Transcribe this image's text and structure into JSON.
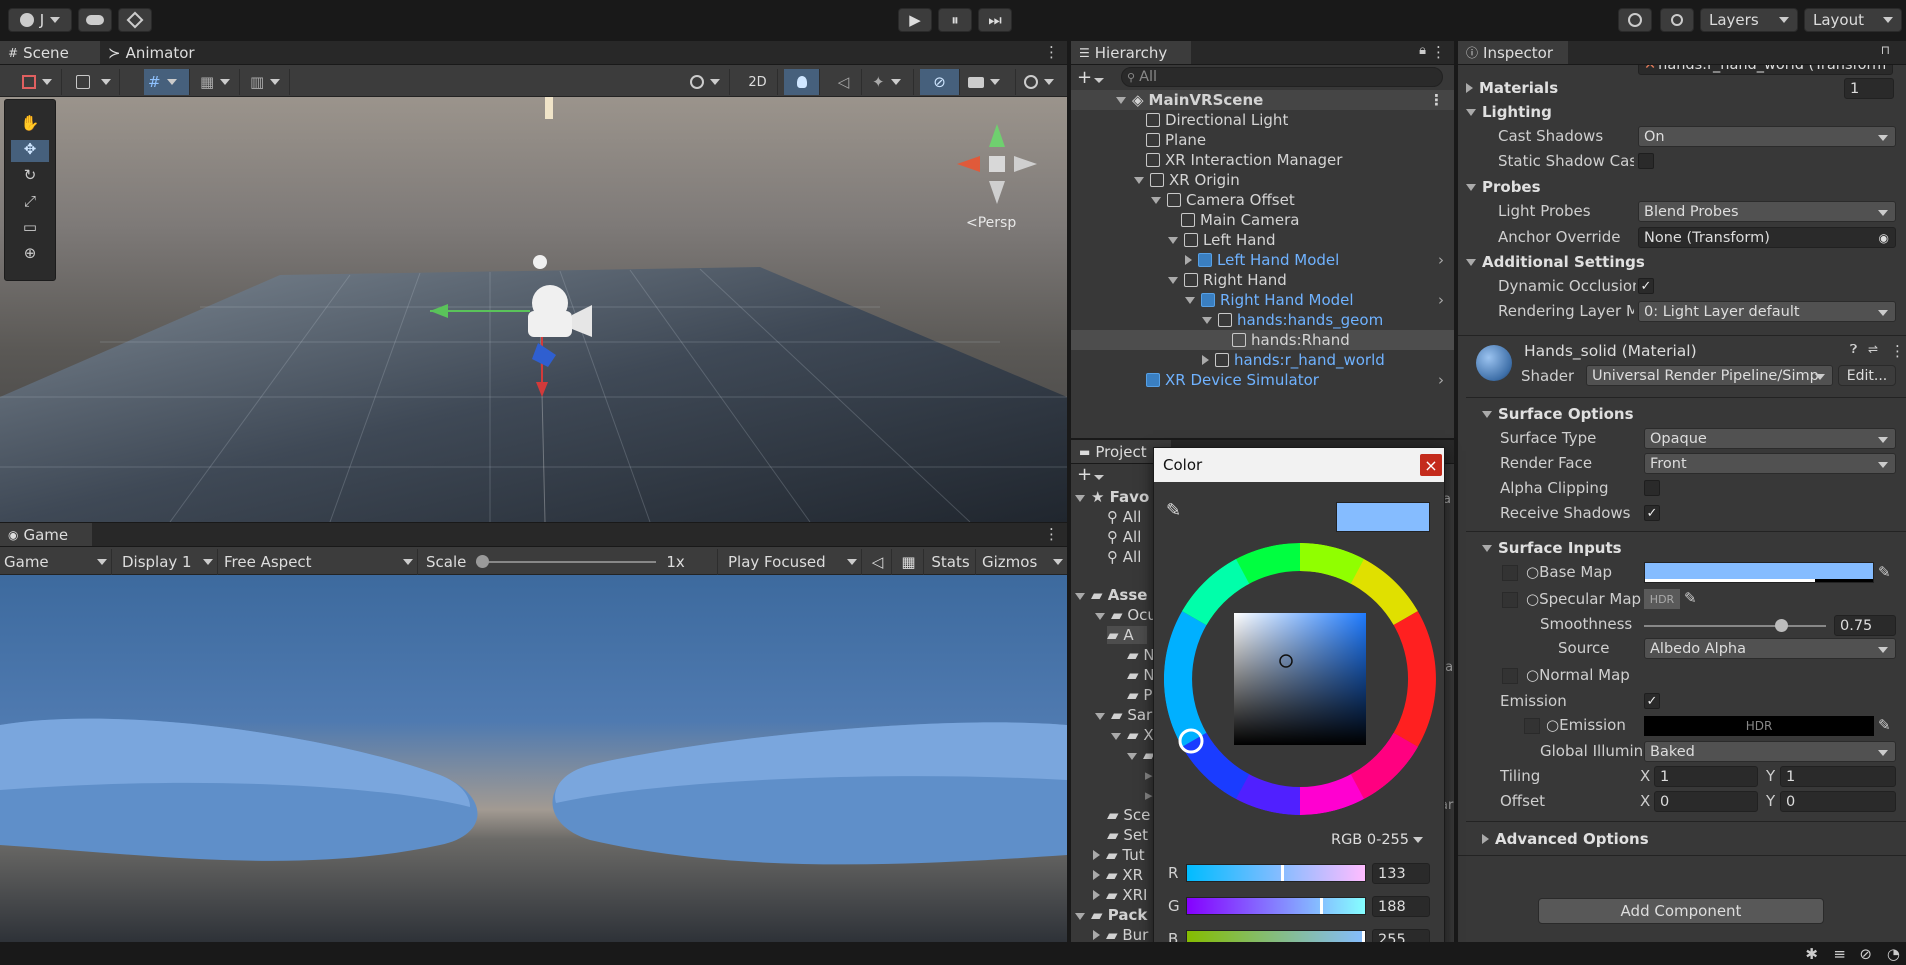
{
  "topbar": {
    "account": "J",
    "play": "▶",
    "pause": "⏸",
    "step": "⏭",
    "layers": "Layers",
    "layout": "Layout"
  },
  "scene": {
    "tabs": [
      "Scene",
      "Animator"
    ],
    "persp": "Persp",
    "mode2d": "2D"
  },
  "game": {
    "tab": "Game",
    "view": "Game",
    "display": "Display 1",
    "aspect": "Free Aspect",
    "scale_label": "Scale",
    "scale_value": "1x",
    "play_mode": "Play Focused",
    "stats": "Stats",
    "gizmos": "Gizmos"
  },
  "hierarchy": {
    "title": "Hierarchy",
    "search_placeholder": "All",
    "items": [
      {
        "label": "MainVRScene"
      },
      {
        "label": "Directional Light"
      },
      {
        "label": "Plane"
      },
      {
        "label": "XR Interaction Manager"
      },
      {
        "label": "XR Origin"
      },
      {
        "label": "Camera Offset"
      },
      {
        "label": "Main Camera"
      },
      {
        "label": "Left Hand"
      },
      {
        "label": "Left Hand Model"
      },
      {
        "label": "Right Hand"
      },
      {
        "label": "Right Hand Model"
      },
      {
        "label": "hands:hands_geom"
      },
      {
        "label": "hands:Rhand"
      },
      {
        "label": "hands:r_hand_world"
      },
      {
        "label": "XR Device Simulator"
      }
    ]
  },
  "project": {
    "title": "Project",
    "favorites": "Favo",
    "fav_items": [
      "All",
      "All",
      "All"
    ],
    "assets": "Asse",
    "folders": [
      "Ocu",
      "A",
      "N",
      "N",
      "P",
      "Sar",
      "X",
      "",
      "",
      "",
      "Sce",
      "Set",
      "Tut",
      "XR",
      "XRI"
    ],
    "packages": "Pack",
    "pkg_first": "Bur",
    "right_frag_a": "a",
    "right_frag_b": "ta",
    "right_frag_c": "ar"
  },
  "color_picker": {
    "title": "Color",
    "close": "×",
    "mode": "RGB 0-255",
    "channels": [
      {
        "label": "R",
        "value": "133"
      },
      {
        "label": "G",
        "value": "188"
      },
      {
        "label": "B",
        "value": "255"
      }
    ],
    "swatch": "#85bcff"
  },
  "inspector": {
    "title": "Inspector",
    "root_bone": "hands:r_hand_world (Transform",
    "materials_label": "Materials",
    "materials_count": "1",
    "lighting": "Lighting",
    "cast_shadows_label": "Cast Shadows",
    "cast_shadows": "On",
    "static_shadow_label": "Static Shadow Cas",
    "probes": "Probes",
    "light_probes_label": "Light Probes",
    "light_probes": "Blend Probes",
    "anchor_label": "Anchor Override",
    "anchor": "None (Transform)",
    "additional": "Additional Settings",
    "dyn_occ_label": "Dynamic Occlusion",
    "render_layer_label": "Rendering Layer M",
    "render_layer": "0: Light Layer default",
    "material_name": "Hands_solid (Material)",
    "shader_label": "Shader",
    "shader": "Universal Render Pipeline/Simp",
    "edit": "Edit...",
    "surface_options": "Surface Options",
    "surface_type_label": "Surface Type",
    "surface_type": "Opaque",
    "render_face_label": "Render Face",
    "render_face": "Front",
    "alpha_clip_label": "Alpha Clipping",
    "receive_shadows_label": "Receive Shadows",
    "surface_inputs": "Surface Inputs",
    "base_map_label": "Base Map",
    "specular_label": "Specular Map",
    "hdr": "HDR",
    "smoothness_label": "Smoothness",
    "smoothness": "0.75",
    "smoothness_level": 0.75,
    "source_label": "Source",
    "source": "Albedo Alpha",
    "normal_label": "Normal Map",
    "emission_label": "Emission",
    "emission_sub": "Emission",
    "gi_label": "Global Illumina",
    "gi": "Baked",
    "tiling_label": "Tiling",
    "offset_label": "Offset",
    "x": "X",
    "y": "Y",
    "tiling_x": "1",
    "tiling_y": "1",
    "offset_x": "0",
    "offset_y": "0",
    "advanced": "Advanced Options",
    "add_component": "Add Component"
  }
}
